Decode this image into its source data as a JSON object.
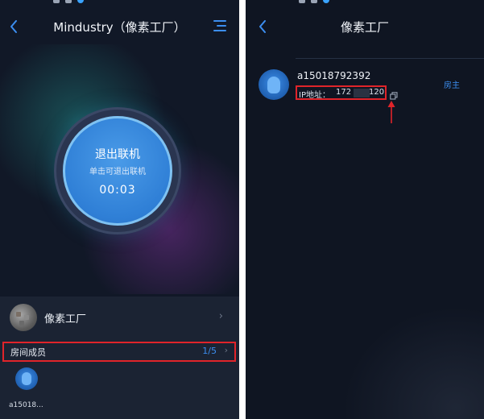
{
  "left": {
    "title": "Mindustry（像素工厂）",
    "disconnect": {
      "label": "退出联机",
      "hint": "单击可退出联机",
      "timer": "00:03"
    },
    "room": {
      "name": "像素工厂",
      "members_label": "房间成员",
      "members_count": "1/5"
    },
    "member": {
      "name": "a15018..."
    }
  },
  "right": {
    "title": "像素工厂",
    "user": {
      "name": "a15018792392",
      "ip_label": "IP地址：",
      "ip_start": "172",
      "ip_end": "120",
      "role": "房主"
    }
  },
  "colors": {
    "accent": "#3c8ef0",
    "highlight": "#e0242a",
    "background": "#111827"
  },
  "icons": [
    "back-icon",
    "menu-icon",
    "chevron-right-icon",
    "copy-icon",
    "arrow-up-icon"
  ]
}
